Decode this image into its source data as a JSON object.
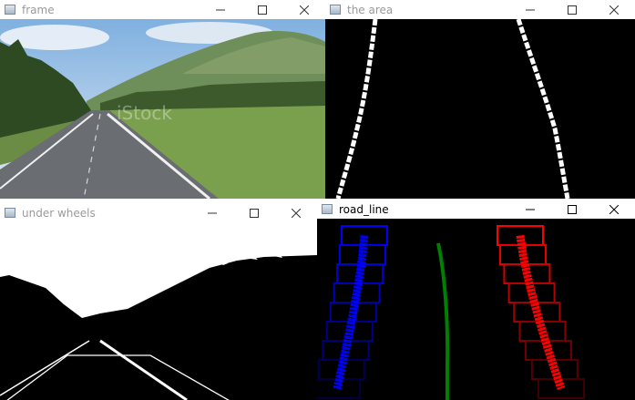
{
  "windows": {
    "frame": {
      "title": "frame",
      "watermark": "iStock"
    },
    "area": {
      "title": "the area"
    },
    "wheels": {
      "title": "under wheels"
    },
    "road": {
      "title": "road_line"
    }
  },
  "controls": {
    "minimize_icon": "minimize-icon",
    "maximize_icon": "maximize-icon",
    "close_icon": "close-icon"
  },
  "colors": {
    "left_lane": "#0000ff",
    "right_lane": "#ff0000",
    "center_line": "#008000",
    "background_dark": "#000000"
  }
}
